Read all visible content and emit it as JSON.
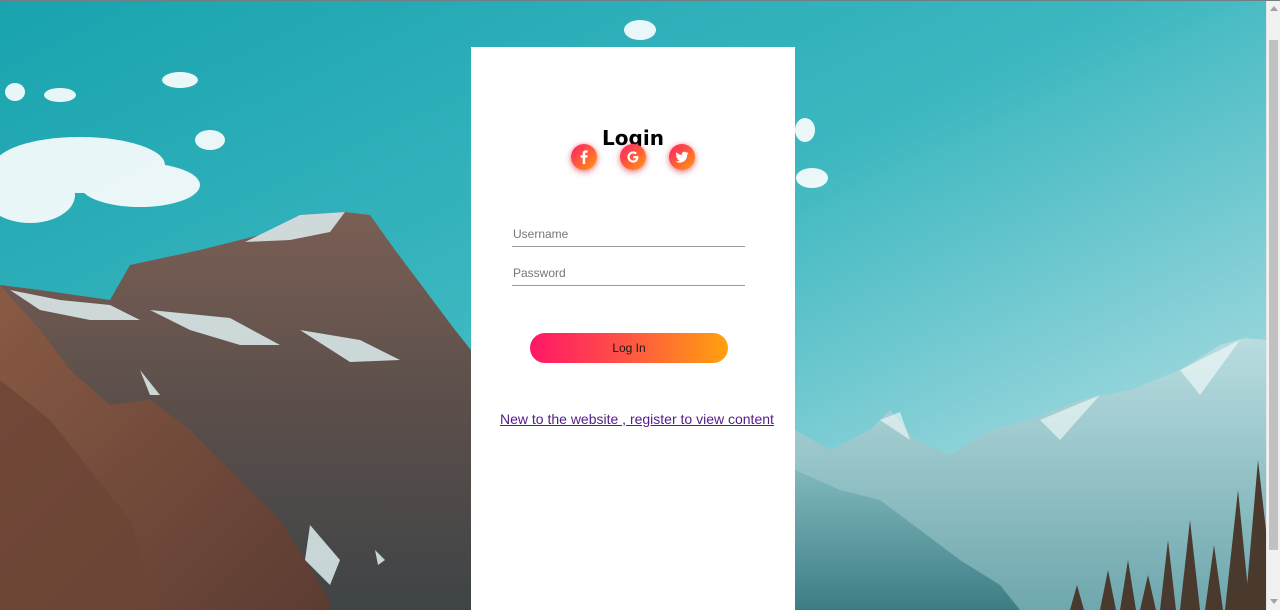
{
  "login": {
    "title": "Login",
    "username_placeholder": "Username",
    "password_placeholder": "Password",
    "submit_label": "Log In",
    "register_link": "New to the website , register to view content"
  },
  "social": [
    {
      "network": "facebook",
      "icon": "facebook-icon"
    },
    {
      "network": "google",
      "icon": "google-icon"
    },
    {
      "network": "twitter",
      "icon": "twitter-icon"
    }
  ],
  "colors": {
    "gradient_start": "#ff1666",
    "gradient_end": "#ffa10c",
    "link": "#551a8b",
    "card": "#ffffff"
  }
}
